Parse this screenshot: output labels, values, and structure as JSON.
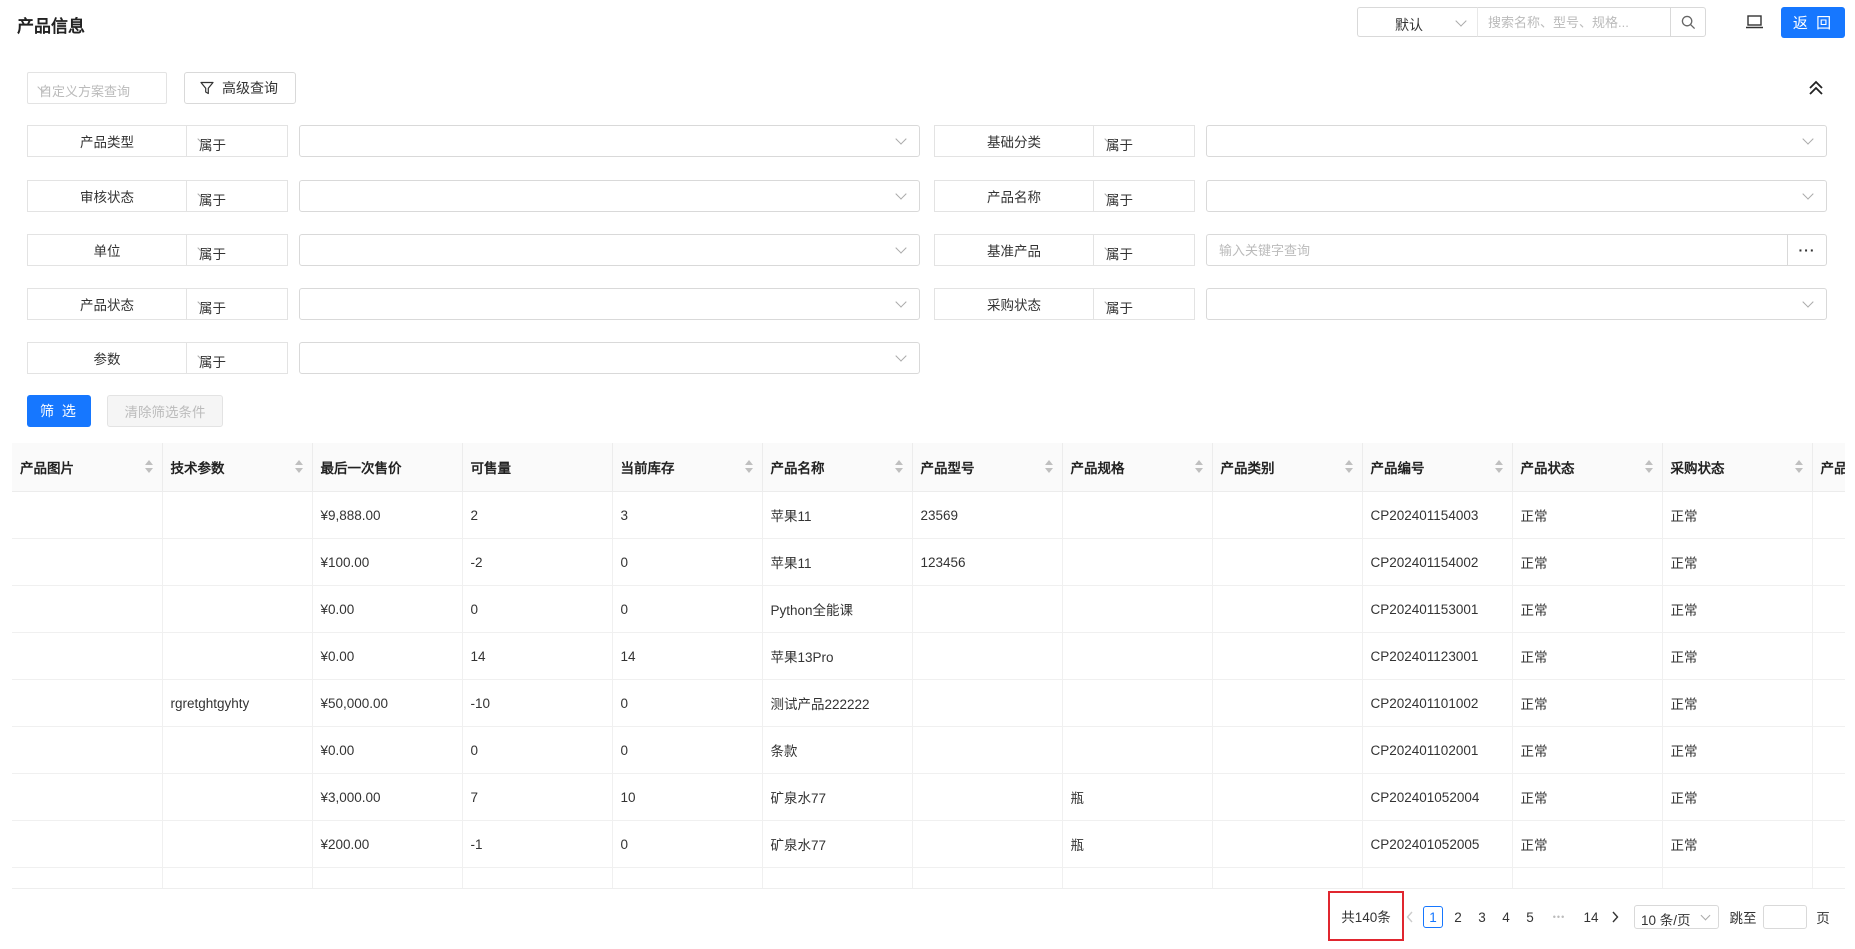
{
  "header": {
    "title": "产品信息",
    "view_select": "默认",
    "search_placeholder": "搜索名称、型号、规格...",
    "back_label": "返 回"
  },
  "toolbar": {
    "scheme_placeholder": "自定义方案查询",
    "advanced_label": "高级查询"
  },
  "filters": {
    "left": [
      {
        "label": "产品类型",
        "op": "属于",
        "placeholder": ""
      },
      {
        "label": "审核状态",
        "op": "属于",
        "placeholder": ""
      },
      {
        "label": "单位",
        "op": "属于",
        "placeholder": ""
      },
      {
        "label": "产品状态",
        "op": "属于",
        "placeholder": ""
      },
      {
        "label": "参数",
        "op": "属于",
        "placeholder": ""
      }
    ],
    "right": [
      {
        "label": "基础分类",
        "op": "属于",
        "placeholder": ""
      },
      {
        "label": "产品名称",
        "op": "属于",
        "placeholder": ""
      },
      {
        "label": "基准产品",
        "op": "属于",
        "placeholder": "输入关键字查询"
      },
      {
        "label": "采购状态",
        "op": "属于",
        "placeholder": ""
      }
    ],
    "filter_button": "筛 选",
    "clear_button": "清除筛选条件"
  },
  "table": {
    "columns": [
      "产品图片",
      "技术参数",
      "最后一次售价",
      "可售量",
      "当前库存",
      "产品名称",
      "产品型号",
      "产品规格",
      "产品类别",
      "产品编号",
      "产品状态",
      "采购状态",
      "产品"
    ],
    "sortable": [
      true,
      true,
      false,
      false,
      true,
      true,
      true,
      true,
      true,
      true,
      true,
      true,
      false
    ],
    "rows": [
      [
        "",
        "",
        "¥9,888.00",
        "2",
        "3",
        "苹果11",
        "23569",
        "",
        "",
        "CP202401154003",
        "正常",
        "正常",
        ""
      ],
      [
        "",
        "",
        "¥100.00",
        "-2",
        "0",
        "苹果11",
        "123456",
        "",
        "",
        "CP202401154002",
        "正常",
        "正常",
        ""
      ],
      [
        "",
        "",
        "¥0.00",
        "0",
        "0",
        "Python全能课",
        "",
        "",
        "",
        "CP202401153001",
        "正常",
        "正常",
        ""
      ],
      [
        "",
        "",
        "¥0.00",
        "14",
        "14",
        "苹果13Pro",
        "",
        "",
        "",
        "CP202401123001",
        "正常",
        "正常",
        ""
      ],
      [
        "",
        "rgretghtgyhty",
        "¥50,000.00",
        "-10",
        "0",
        "测试产品222222",
        "",
        "",
        "",
        "CP202401101002",
        "正常",
        "正常",
        ""
      ],
      [
        "",
        "",
        "¥0.00",
        "0",
        "0",
        "条款",
        "",
        "",
        "",
        "CP202401102001",
        "正常",
        "正常",
        ""
      ],
      [
        "",
        "",
        "¥3,000.00",
        "7",
        "10",
        "矿泉水77",
        "",
        "瓶",
        "",
        "CP202401052004",
        "正常",
        "正常",
        ""
      ],
      [
        "",
        "",
        "¥200.00",
        "-1",
        "0",
        "矿泉水77",
        "",
        "瓶",
        "",
        "CP202401052005",
        "正常",
        "正常",
        ""
      ],
      [
        "",
        "",
        "",
        "",
        "",
        "",
        "",
        "",
        "",
        "",
        "",
        "",
        ""
      ]
    ]
  },
  "pagination": {
    "total": "共140条",
    "pages": [
      "1",
      "2",
      "3",
      "4",
      "5"
    ],
    "ellipsis": "•••",
    "last_page": "14",
    "current": "1",
    "page_size": "10 条/页",
    "jump_label": "跳至",
    "page_suffix": "页"
  }
}
